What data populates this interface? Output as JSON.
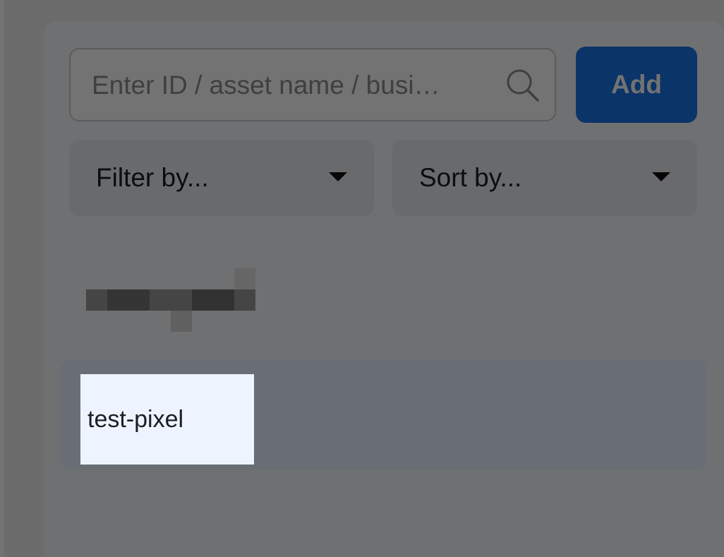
{
  "search": {
    "placeholder": "Enter ID / asset name / busi…",
    "icon": "search-icon"
  },
  "add_button": {
    "label": "Add"
  },
  "filter": {
    "label": "Filter by...",
    "icon": "caret-down-icon"
  },
  "sort": {
    "label": "Sort by...",
    "icon": "caret-down-icon"
  },
  "items": [
    {
      "label": "test-pixel",
      "selected": true
    }
  ],
  "colors": {
    "accent": "#1a73e8",
    "overlay": "#000000",
    "selected_row": "#e7f3ff"
  }
}
